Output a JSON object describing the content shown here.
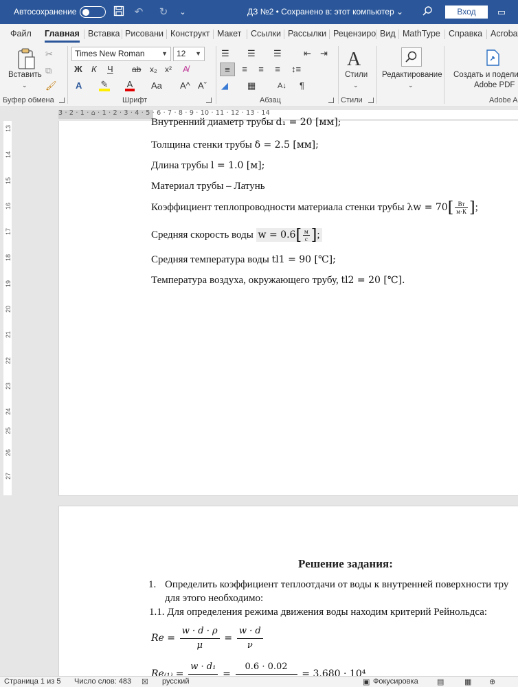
{
  "titlebar": {
    "autosave_label": "Автосохранение",
    "doc_title": "ДЗ №2 • Сохранено в: этот компьютер ⌄",
    "signin_label": "Вход"
  },
  "tabs": [
    "Файл",
    "Главная",
    "Вставка",
    "Рисовани",
    "Конструкт",
    "Макет",
    "Ссылки",
    "Рассылки",
    "Рецензиро",
    "Вид",
    "MathType",
    "Справка",
    "Acrobat"
  ],
  "ribbon": {
    "paste_label": "Вставить",
    "font_name": "Times New Roman",
    "font_size": "12",
    "styles_label": "Стили",
    "editing_label": "Редактирование",
    "adobe_label_line1": "Создать и поделит",
    "adobe_label_line2": "Adobe PDF",
    "groups": {
      "clipboard": "Буфер обмена",
      "font": "Шрифт",
      "paragraph": "Абзац",
      "styles": "Стили",
      "adobe": "Adobe A"
    },
    "font_buttons": {
      "bold": "Ж",
      "italic": "К",
      "underline": "Ч",
      "strike": "ab",
      "sub": "x₂",
      "sup": "x²",
      "grow": "A^",
      "shrink": "Aˇ",
      "case": "Aa"
    }
  },
  "ruler": {
    "h_scale": "3 · 2 · 1 · ⌂ · 1 · 2 · 3 · 4 · 5 · 6 · 7 · 8 · 9 · 10 · 11 · 12 · 13 · 14",
    "v_numbers": [
      "13",
      "14",
      "15",
      "16",
      "17",
      "18",
      "19",
      "20",
      "21",
      "22",
      "23",
      "24",
      "25",
      "26",
      "27"
    ]
  },
  "page1": {
    "line1_text": "Внутренний диаметр трубы ",
    "line1_math": "d₁ = 20 [мм];",
    "line2_text": "Толщина стенки трубы ",
    "line2_math": "δ = 2.5 [мм];",
    "line3_text": "Длина трубы ",
    "line3_math": "l = 1.0 [м];",
    "line4_text": "Материал трубы – Латунь",
    "line5_text": "Коэффициент теплопроводности материала стенки трубы ",
    "line5_math": "λw = 70",
    "line5_unit_num": "Вт",
    "line5_unit_den": "м·К",
    "line6_text": "Средняя скорость воды ",
    "line6_math": "w = 0.6",
    "line6_unit_num": "м",
    "line6_unit_den": "с",
    "line7_text": "Средняя температура воды ",
    "line7_math": "tl1 = 90 [℃];",
    "line8_text": "Температура воздуха, окружающего трубу, ",
    "line8_math": "tl2 = 20 [℃]."
  },
  "page2": {
    "heading": "Решение задания:",
    "item1_num": "1.",
    "item1_line1": "Определить коэффициент теплоотдачи от воды к внутренней поверхности тру",
    "item1_line2": "для этого необходимо:",
    "item11": "1.1. Для определения режима движения воды находим критерий Рейнольдса:",
    "eq1_lhs": "Re =",
    "eq1_num1": "w · d · ρ",
    "eq1_den1": "μ",
    "eq1_eq": "=",
    "eq1_num2": "w · d",
    "eq1_den2": "ν",
    "eq2_lhs": "Re₍₁₎ =",
    "eq2_num1": "w · d₁",
    "eq2_num2": "0.6 · 0.02",
    "eq2_rhs": "= 3.680 · 10⁴"
  },
  "statusbar": {
    "page": "Страница 1 из 5",
    "words": "Число слов: 483",
    "language": "русский",
    "focus": "Фокусировка"
  },
  "colors": {
    "accent": "#2b579a",
    "ribbon_bg": "#f3f3f3",
    "canvas": "#e6e6e6"
  }
}
